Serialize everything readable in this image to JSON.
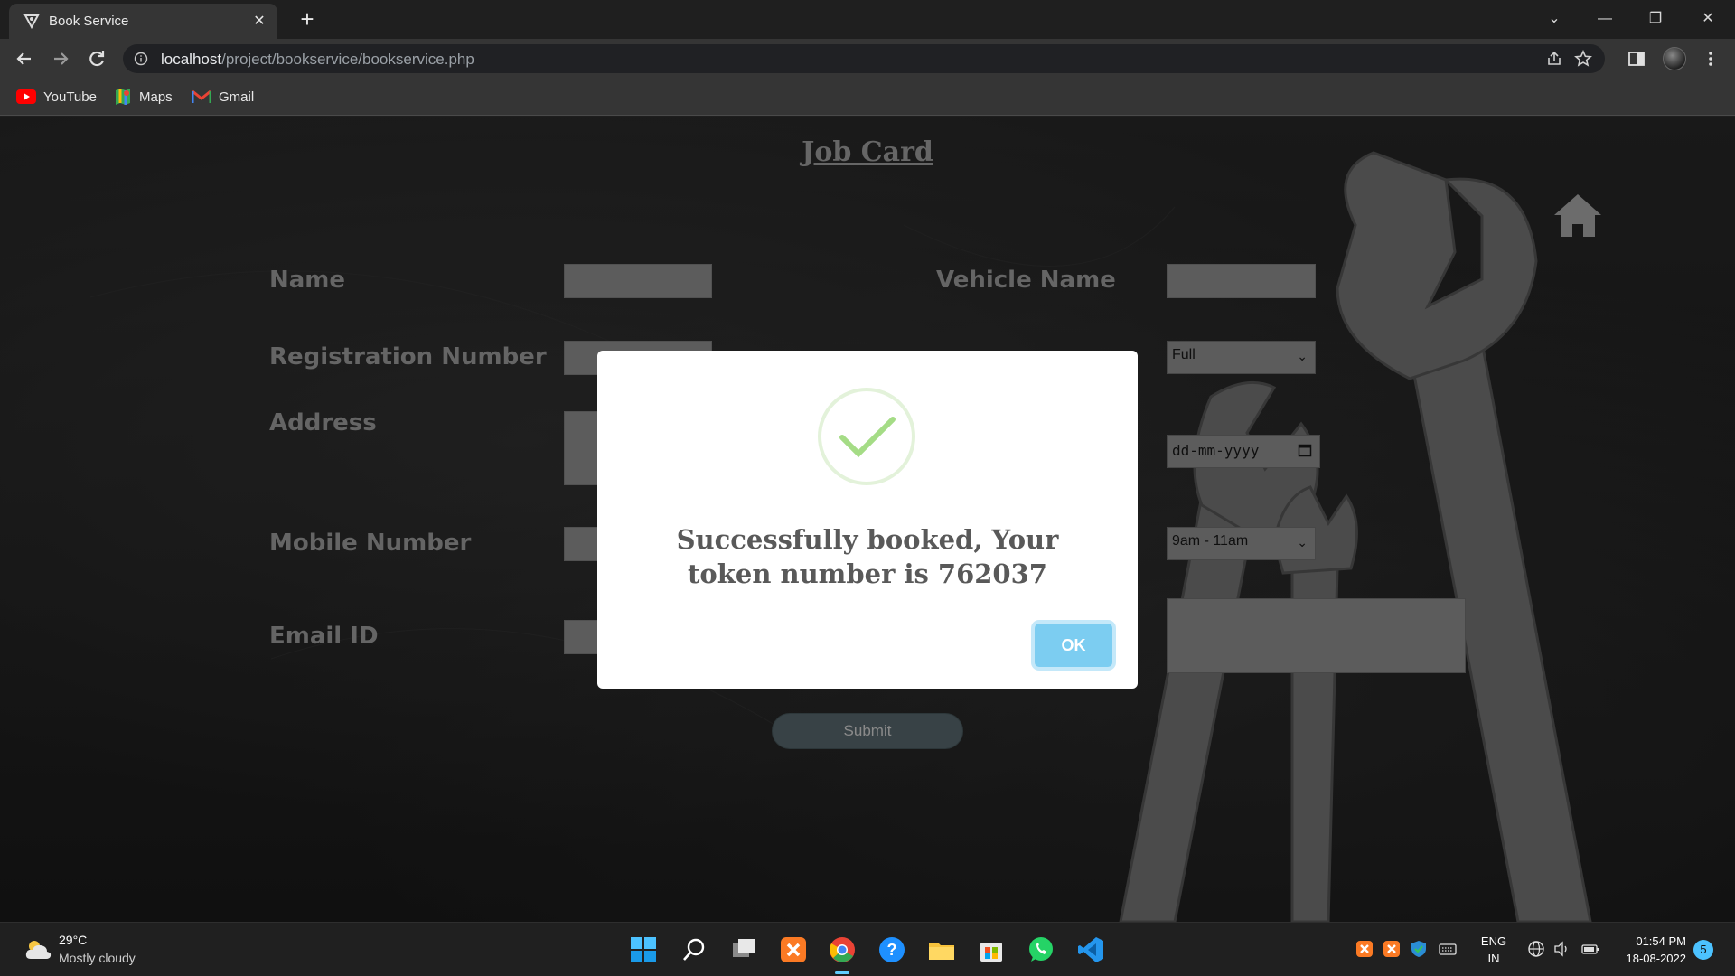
{
  "browser": {
    "tab_title": "Book Service",
    "url_host": "localhost",
    "url_path": "/project/bookservice/bookservice.php",
    "bookmarks": [
      "YouTube",
      "Maps",
      "Gmail"
    ]
  },
  "page": {
    "title": "Job Card",
    "labels": {
      "name": "Name",
      "vehicle_name": "Vehicle Name",
      "registration_number": "Registration Number",
      "address": "Address",
      "mobile_number": "Mobile Number",
      "email_id": "Email ID"
    },
    "service_type_value": "Full",
    "date_placeholder": "dd-mm-yyyy",
    "time_slot_value": "9am - 11am",
    "submit_label": "Submit"
  },
  "modal": {
    "message": "Successfully booked, Your token number is 762037",
    "ok_label": "OK",
    "accent_color": "#7ccdf1",
    "check_color": "#a5dc86"
  },
  "taskbar": {
    "weather_temp": "29°C",
    "weather_desc": "Mostly cloudy",
    "lang_1": "ENG",
    "lang_2": "IN",
    "time": "01:54 PM",
    "date": "18-08-2022",
    "notification_count": "5"
  }
}
